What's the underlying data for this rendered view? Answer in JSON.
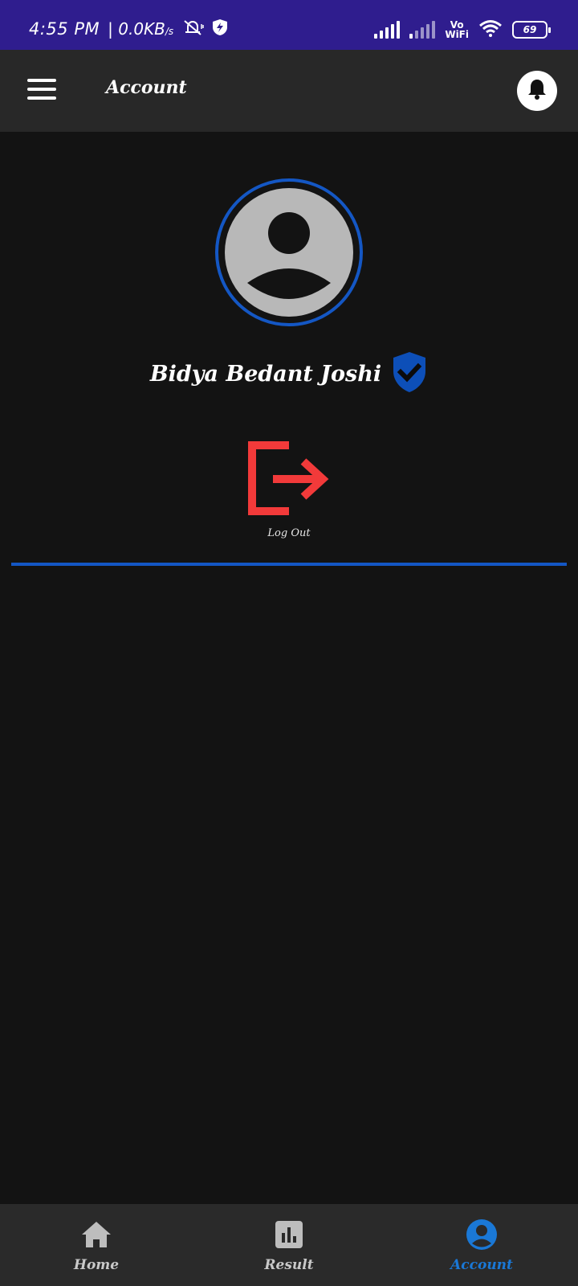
{
  "status_bar": {
    "time": "4:55 PM",
    "network_speed": "0.0KB",
    "network_unit": "/s",
    "vowifi": [
      "Vo",
      "WiFi"
    ],
    "battery": "69"
  },
  "app_bar": {
    "title": "Account",
    "menu_icon": "hamburger-menu-icon",
    "bell_icon": "bell-icon"
  },
  "profile": {
    "name": "Bidya Bedant Joshi",
    "verified_icon": "verified-shield-icon"
  },
  "logout": {
    "label": "Log Out",
    "icon": "logout-icon"
  },
  "bottom_nav": {
    "items": [
      {
        "label": "Home",
        "icon": "home-icon",
        "active": false
      },
      {
        "label": "Result",
        "icon": "bar-chart-icon",
        "active": false
      },
      {
        "label": "Account",
        "icon": "account-circle-icon",
        "active": true
      }
    ]
  },
  "colors": {
    "status_bar": "#2f1d8e",
    "app_bar": "#282828",
    "background": "#131313",
    "accent_blue": "#1457c4",
    "active_nav": "#1a78d6",
    "logout_red": "#f23a3a"
  }
}
